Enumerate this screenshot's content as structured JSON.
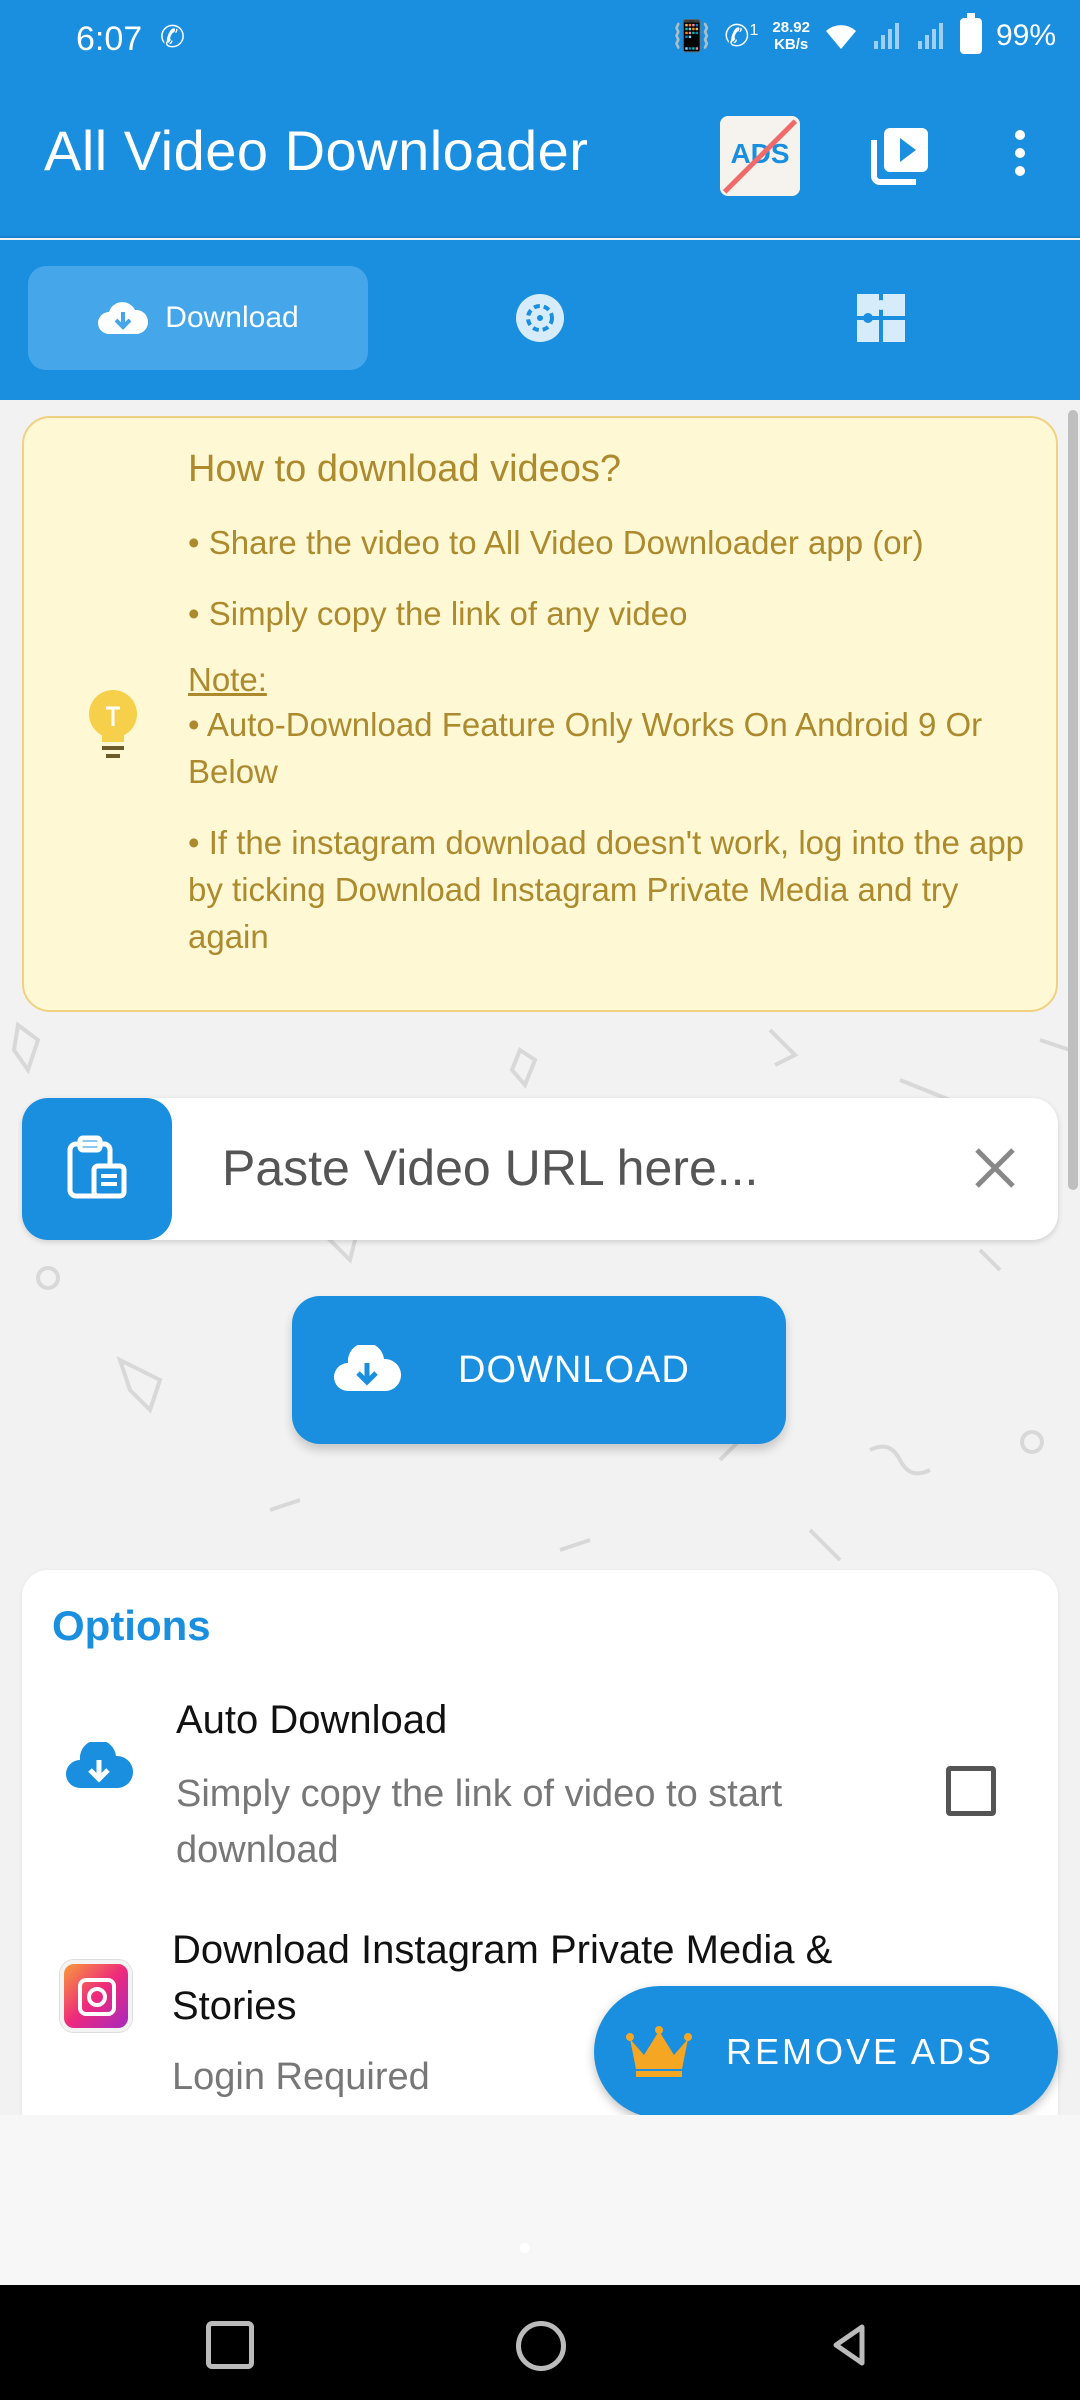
{
  "status_bar": {
    "time": "6:07",
    "network_speed_value": "28.92",
    "network_speed_unit": "KB/s",
    "call_indicator": "1",
    "battery": "99%"
  },
  "app_bar": {
    "title": "All Video Downloader",
    "no_ads_icon_text": "ADS"
  },
  "tabs": [
    {
      "label": "Download",
      "icon": "cloud-download-icon",
      "selected": true
    },
    {
      "label": "",
      "icon": "status-saver-icon",
      "selected": false
    },
    {
      "label": "",
      "icon": "puzzle-icon",
      "selected": false
    }
  ],
  "info_card": {
    "title": "How to download videos?",
    "line1": "• Share the video to All Video Downloader app (or)",
    "line2": "• Simply copy the link of any video",
    "note_label": "Note:",
    "note1": "• Auto-Download Feature Only Works On Android 9 Or Below",
    "note2": "• If the instagram download doesn't work, log into the app by ticking Download Instagram Private Media and try again"
  },
  "url_input": {
    "placeholder": "Paste Video URL here...",
    "value": ""
  },
  "download_button": {
    "label": "DOWNLOAD"
  },
  "options": {
    "title": "Options",
    "auto_download": {
      "title": "Auto Download",
      "description": "Simply copy the link of video to start download",
      "checked": false
    },
    "instagram": {
      "title": "Download Instagram Private Media  & Stories",
      "description": "Login Required"
    }
  },
  "remove_ads": {
    "label": "REMOVE ADS"
  },
  "colors": {
    "primary": "#1a8fe0",
    "info_bg": "#fef8d4",
    "info_text": "#ac8a2d",
    "accent_crown": "#f5a623"
  }
}
